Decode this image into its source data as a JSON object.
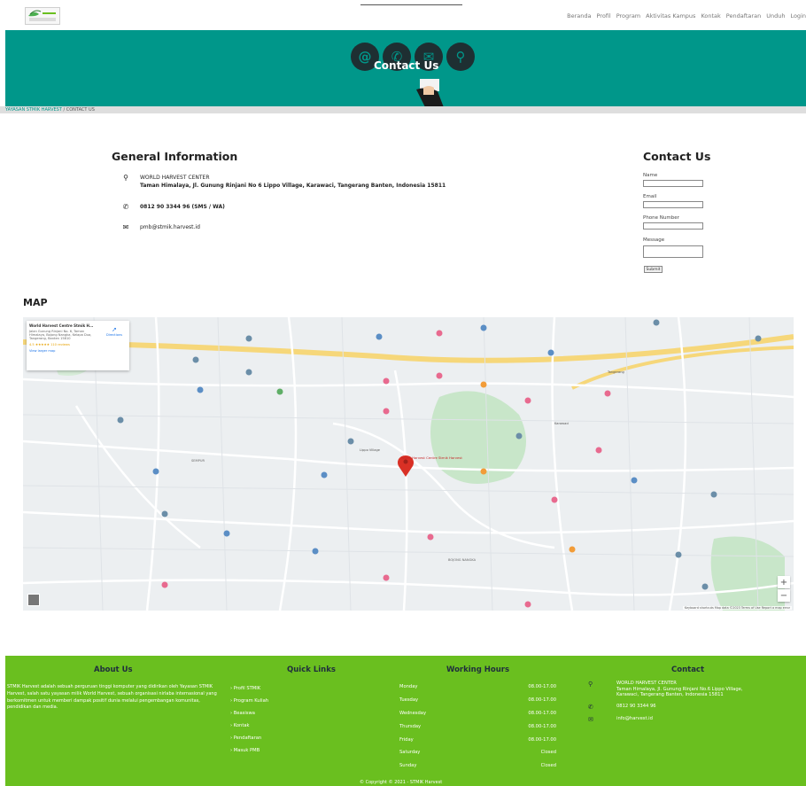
{
  "nav": {
    "items": [
      "Beranda",
      "Profil",
      "Program",
      "Aktivitas Kampus",
      "Kontak",
      "Pendaftaran",
      "Unduh",
      "Login"
    ]
  },
  "hero": {
    "title": "Contact Us"
  },
  "breadcrumb": {
    "home": "YAYASAN STMIK HARVEST",
    "separator": " / ",
    "current": "CONTACT US"
  },
  "general": {
    "title": "General Information",
    "org_name": "WORLD HARVEST CENTER",
    "address": "Taman Himalaya, Jl. Gunung Rinjani No 6 Lippo Village, Karawaci, Tangerang Banten, Indonesia 15811",
    "phone": "0812 90 3344 96 (SMS / WA)",
    "email": "pmb@stmik.harvest.id"
  },
  "contact_form": {
    "title": "Contact Us",
    "name_label": "Name",
    "email_label": "Email",
    "phone_label": "Phone Number",
    "message_label": "Message",
    "submit_label": "Submit"
  },
  "map": {
    "title": "MAP",
    "card_name": "World Harvest Centre Stmik H...",
    "card_address": "Jalan Gunung Rinjani No. 6, Taman Himalaya, Bojong Nangka, Kelapa Dua, Tangerang, Banten 15810",
    "card_rating": "4.5 ★★★★★ 110 reviews",
    "card_largemap": "View larger map",
    "card_directions": "Directions",
    "center_label": "World Harvest Centre Stmik Harvest",
    "zoom_in": "+",
    "zoom_out": "−",
    "attribution": "Keyboard shortcuts   Map data ©2023   Terms of Use   Report a map error",
    "labels": [
      "Lippo Village",
      "Tangerang",
      "Karawaci",
      "SEMPUR",
      "BOJONG NANGKA"
    ]
  },
  "footer": {
    "about_title": "About Us",
    "about_text": "STMIK Harvest adalah sebuah perguruan tinggi komputer yang didirikan oleh Yayasan STMIK Harvest, salah satu yayasan milik World Harvest, sebuah organisasi nirlaba internasional yang berkomitmen untuk memberi dampak positif dunia melalui pengembangan komunitas, pendidikan dan media.",
    "links_title": "Quick Links",
    "links": [
      "Profil STMIK",
      "Program Kuliah",
      "Beasiswa",
      "Kontak",
      "Pendaftaran",
      "Masuk PMB"
    ],
    "hours_title": "Working Hours",
    "hours": [
      {
        "day": "Monday",
        "time": "08.00-17.00"
      },
      {
        "day": "Tuesday",
        "time": "08.00-17.00"
      },
      {
        "day": "Wednesday",
        "time": "08.00-17.00"
      },
      {
        "day": "Thursday",
        "time": "08.00-17.00"
      },
      {
        "day": "Friday",
        "time": "08.00-17.00"
      },
      {
        "day": "Saturday",
        "time": "Closed"
      },
      {
        "day": "Sunday",
        "time": "Closed"
      }
    ],
    "contact_title": "Contact",
    "contact_org": "WORLD HARVEST CENTER",
    "contact_address": "Taman Himalaya, Jl. Gunung Rinjani No.6 Lippo Village, Karawaci, Tangerang Banten, Indonesia 15811",
    "contact_phone": "0812 90 3344 96",
    "contact_email": "info@harvest.id",
    "copyright": "© Copyright © 2021 - STMIK Harvest"
  },
  "colors": {
    "teal": "#00978a",
    "green": "#6abf1f",
    "dark": "#1f2d3d"
  }
}
